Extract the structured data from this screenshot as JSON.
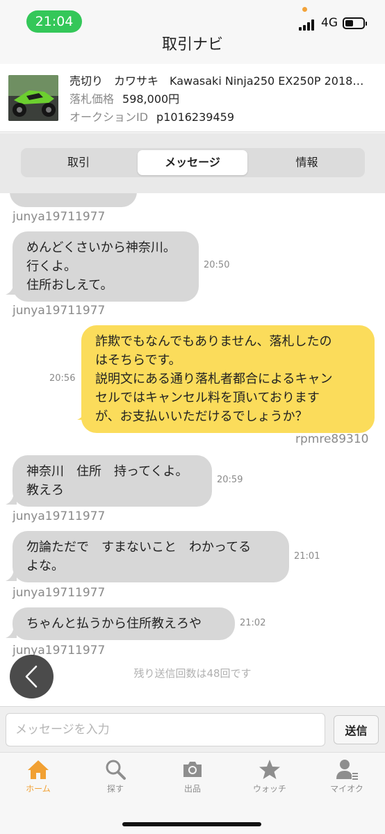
{
  "status_bar": {
    "time": "21:04",
    "network": "4G"
  },
  "nav": {
    "title": "取引ナビ"
  },
  "item": {
    "title": "売切り　カワサキ　Kawasaki Ninja250 EX250P 2018…",
    "price_label": "落札価格",
    "price": "598,000円",
    "auction_label": "オークションID",
    "auction_id": "p1016239459"
  },
  "tabs": [
    "取引",
    "メッセージ",
    "情報"
  ],
  "chat": {
    "cut_user": "junya19711977",
    "messages": [
      {
        "side": "in",
        "lines": [
          "めんどくさいから神奈川。",
          "行くよ。",
          "住所おしえて。"
        ],
        "time": "20:50",
        "user": "junya19711977"
      },
      {
        "side": "out",
        "lines": [
          "詐欺でもなんでもありません、落札したの",
          "はそちらです。",
          "説明文にある通り落札者都合によるキャン",
          "セルではキャンセル料を頂いております",
          "が、お支払いいただけるでしょうか？"
        ],
        "time": "20:56",
        "user": "rpmre89310"
      },
      {
        "side": "in",
        "lines": [
          "神奈川　住所　持ってくよ。",
          "教えろ"
        ],
        "time": "20:59",
        "user": "junya19711977"
      },
      {
        "side": "in",
        "lines": [
          "勿論ただで　すまないこと　わかってる",
          "よな。"
        ],
        "time": "21:01",
        "user": "junya19711977"
      },
      {
        "side": "in",
        "lines": [
          "ちゃんと払うから住所教えろや"
        ],
        "time": "21:02",
        "user": "junya19711977"
      }
    ],
    "remaining_text": "残り送信回数は48回です"
  },
  "input": {
    "placeholder": "メッセージを入力",
    "send_label": "送信"
  },
  "tabbar": [
    {
      "label": "ホーム",
      "icon": "home-icon"
    },
    {
      "label": "探す",
      "icon": "search-icon"
    },
    {
      "label": "出品",
      "icon": "camera-icon"
    },
    {
      "label": "ウォッチ",
      "icon": "star-icon"
    },
    {
      "label": "マイオク",
      "icon": "user-list-icon"
    }
  ],
  "colors": {
    "accent": "#f1a033",
    "outgoing_bubble": "#fbdc5b",
    "incoming_bubble": "#d7d7d7",
    "status_pill": "#34c759"
  }
}
